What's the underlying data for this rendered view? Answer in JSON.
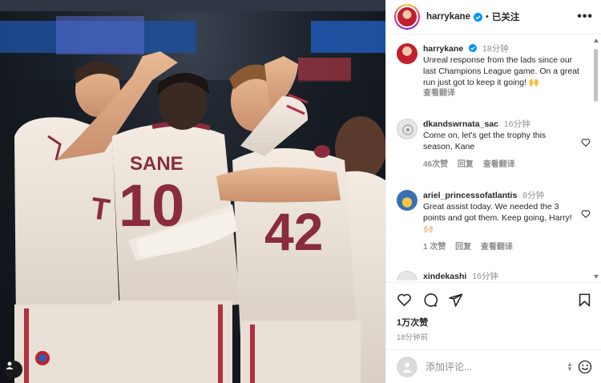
{
  "post": {
    "author": "harrykane",
    "verified": true,
    "follow_state": "已关注",
    "more_label": "•••"
  },
  "photo": {
    "jersey_left_name": "SANE",
    "jersey_left_number": "10",
    "jersey_right_number": "42",
    "sponsor_text": "T",
    "background_color": "#1c222b",
    "kit_color": "#efe6dc",
    "kit_accent": "#8a2c3e"
  },
  "caption": {
    "user": "harrykane",
    "time": "18分钟",
    "text": "Unreal response from the lads since our last Champions League game. On a great run just got to keep it going! 🙌",
    "translate": "查看翻译"
  },
  "comments": [
    {
      "user": "dkandswrnata_sac",
      "time": "16分钟",
      "text": "Come on, let's get the trophy this season, Kane",
      "likes": "46次赞",
      "reply": "回复",
      "translate": "查看翻译"
    },
    {
      "user": "ariel_princessofatlantis",
      "time": "8分钟",
      "text": "Great assist today. We needed the 3 points and got them. Keep going, Harry! 🙌🏻",
      "likes": "1 次赞",
      "reply": "回复",
      "translate": "查看翻译"
    },
    {
      "user": "xindekashi",
      "time": "16分钟",
      "text": ""
    }
  ],
  "engagement": {
    "likes": "1万次赞",
    "posted": "18分钟前"
  },
  "add_comment": {
    "placeholder": "添加评论...",
    "icon": "emoji-icon"
  },
  "colors": {
    "verified_blue": "#0095f6",
    "muted_text": "#8e8e8e",
    "text": "#262626"
  }
}
